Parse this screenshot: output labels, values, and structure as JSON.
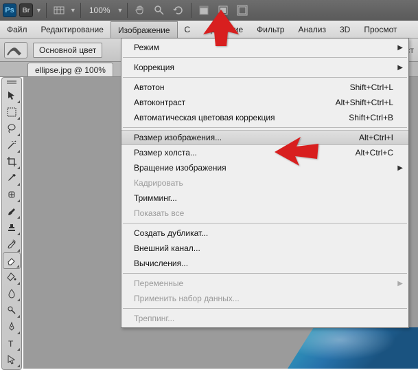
{
  "toolbar": {
    "ps": "Ps",
    "br": "Br",
    "zoom": "100%"
  },
  "menubar": {
    "items": [
      "Файл",
      "Редактирование",
      "Изображение",
      "С",
      "деление",
      "Фильтр",
      "Анализ",
      "3D",
      "Просмот"
    ]
  },
  "options": {
    "colorMode": "Основной цвет",
    "rightLabel": "пуст"
  },
  "docTab": {
    "title": "ellipse.jpg @ 100%"
  },
  "menu": {
    "mode": {
      "label": "Режим"
    },
    "correction": {
      "label": "Коррекция"
    },
    "autotone": {
      "label": "Автотон",
      "shortcut": "Shift+Ctrl+L"
    },
    "autocontrast": {
      "label": "Автоконтраст",
      "shortcut": "Alt+Shift+Ctrl+L"
    },
    "autocolor": {
      "label": "Автоматическая цветовая коррекция",
      "shortcut": "Shift+Ctrl+B"
    },
    "imagesize": {
      "label": "Размер изображения...",
      "shortcut": "Alt+Ctrl+I"
    },
    "canvassize": {
      "label": "Размер холста...",
      "shortcut": "Alt+Ctrl+C"
    },
    "rotate": {
      "label": "Вращение изображения"
    },
    "crop": {
      "label": "Кадрировать"
    },
    "trim": {
      "label": "Тримминг..."
    },
    "revealall": {
      "label": "Показать все"
    },
    "duplicate": {
      "label": "Создать дубликат..."
    },
    "applyimage": {
      "label": "Внешний канал..."
    },
    "calculations": {
      "label": "Вычисления..."
    },
    "variables": {
      "label": "Переменные"
    },
    "applydata": {
      "label": "Применить набор данных..."
    },
    "trap": {
      "label": "Треппинг..."
    }
  }
}
